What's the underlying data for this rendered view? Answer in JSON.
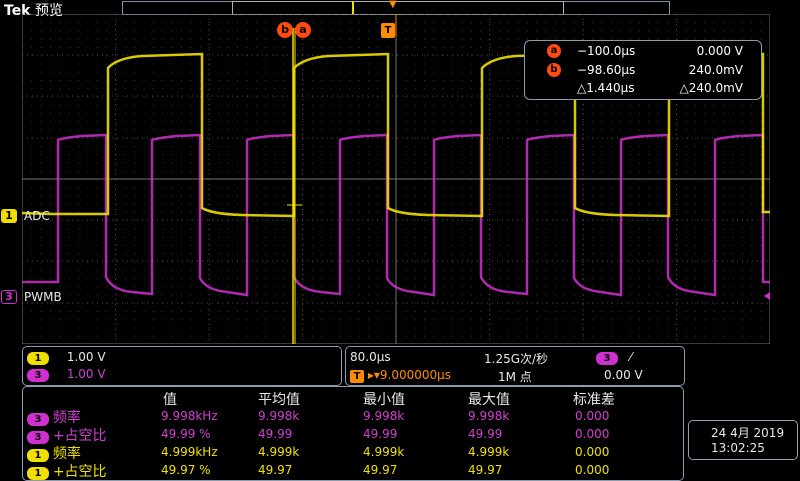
{
  "brand": {
    "name": "Tek",
    "mode": "预览"
  },
  "colors": {
    "ch1": "#f0e000",
    "ch3": "#d030d0",
    "cursor": "#ff4a10",
    "trigger": "#ff8c00",
    "frame": "#8c9bb0"
  },
  "channels": {
    "ch1": {
      "number": "1",
      "label": "ADC"
    },
    "ch3": {
      "number": "3",
      "label": "PWMB"
    }
  },
  "markers": {
    "cursor_a": "a",
    "cursor_b": "b",
    "trigger": "T"
  },
  "cursors": {
    "a": {
      "time": "−100.0µs",
      "value": "0.000 V"
    },
    "b": {
      "time": "−98.60µs",
      "value": "240.0mV"
    },
    "delta": {
      "time": "△1.440µs",
      "value": "△240.0mV"
    }
  },
  "scale": {
    "ch1": {
      "number": "1",
      "volts": "1.00 V"
    },
    "ch3": {
      "number": "3",
      "volts": "1.00 V"
    }
  },
  "timebase": {
    "horizontal": "80.0µs",
    "sample_rate": "1.25G次/秒",
    "trigger_icon": "T",
    "position": "▸▾9.000000µs",
    "record_length": "1M 点",
    "trigger_source": "3",
    "trigger_slope": "⁄",
    "trigger_level": "0.00 V"
  },
  "measurements": {
    "headers": [
      "值",
      "平均值",
      "最小值",
      "最大值",
      "标准差"
    ],
    "rows": [
      {
        "ch": "3",
        "name": "频率",
        "values": [
          "9.998kHz",
          "9.998k",
          "9.998k",
          "9.998k",
          "0.000"
        ]
      },
      {
        "ch": "3",
        "name": "+占空比",
        "values": [
          "49.99 %",
          "49.99",
          "49.99",
          "49.99",
          "0.000"
        ]
      },
      {
        "ch": "1",
        "name": "频率",
        "values": [
          "4.999kHz",
          "4.999k",
          "4.999k",
          "4.999k",
          "0.000"
        ]
      },
      {
        "ch": "1",
        "name": "+占空比",
        "values": [
          "49.97 %",
          "49.97",
          "49.97",
          "49.97",
          "0.000"
        ]
      }
    ]
  },
  "datetime": {
    "date": "24 4月 2019",
    "time": "13:02:25"
  }
}
